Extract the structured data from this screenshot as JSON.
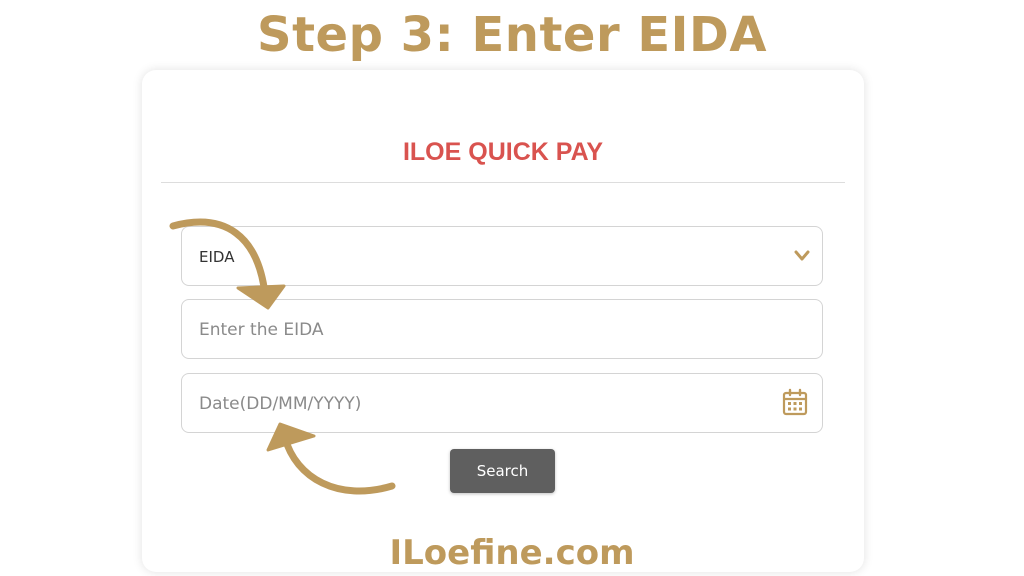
{
  "heading": "Step 3: Enter EIDA",
  "form": {
    "title": "ILOE QUICK PAY",
    "id_type_select": {
      "value": "EIDA",
      "icon": "chevron-down-icon"
    },
    "eida_input": {
      "placeholder": "Enter the EIDA"
    },
    "date_input": {
      "placeholder": "Date(DD/MM/YYYY)",
      "icon": "calendar-icon"
    },
    "search_label": "Search"
  },
  "watermark": "ILoefine.com",
  "colors": {
    "accent_gold": "#BE9A5C",
    "title_red": "#D9534F",
    "button_gray": "#5F5F5F"
  }
}
